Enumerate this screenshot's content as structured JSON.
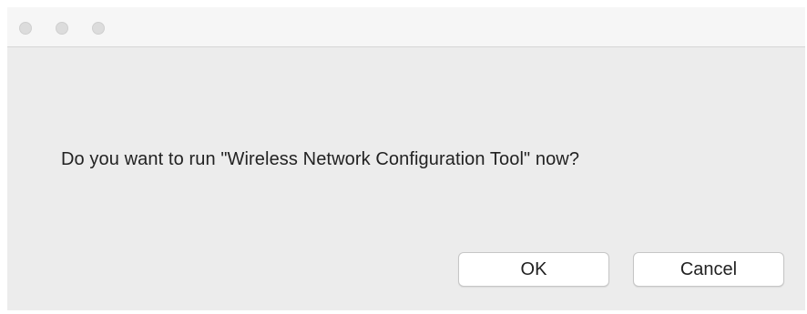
{
  "window": {
    "traffic_lights": [
      "close",
      "minimize",
      "zoom"
    ]
  },
  "dialog": {
    "message": "Do you want to run \"Wireless Network Configuration Tool\" now?",
    "ok_label": "OK",
    "cancel_label": "Cancel"
  },
  "colors": {
    "window_bg": "#ececec",
    "titlebar_bg": "#f6f6f6",
    "traffic_inactive": "#dcdcdc",
    "button_bg": "#ffffff",
    "text": "#222222"
  }
}
